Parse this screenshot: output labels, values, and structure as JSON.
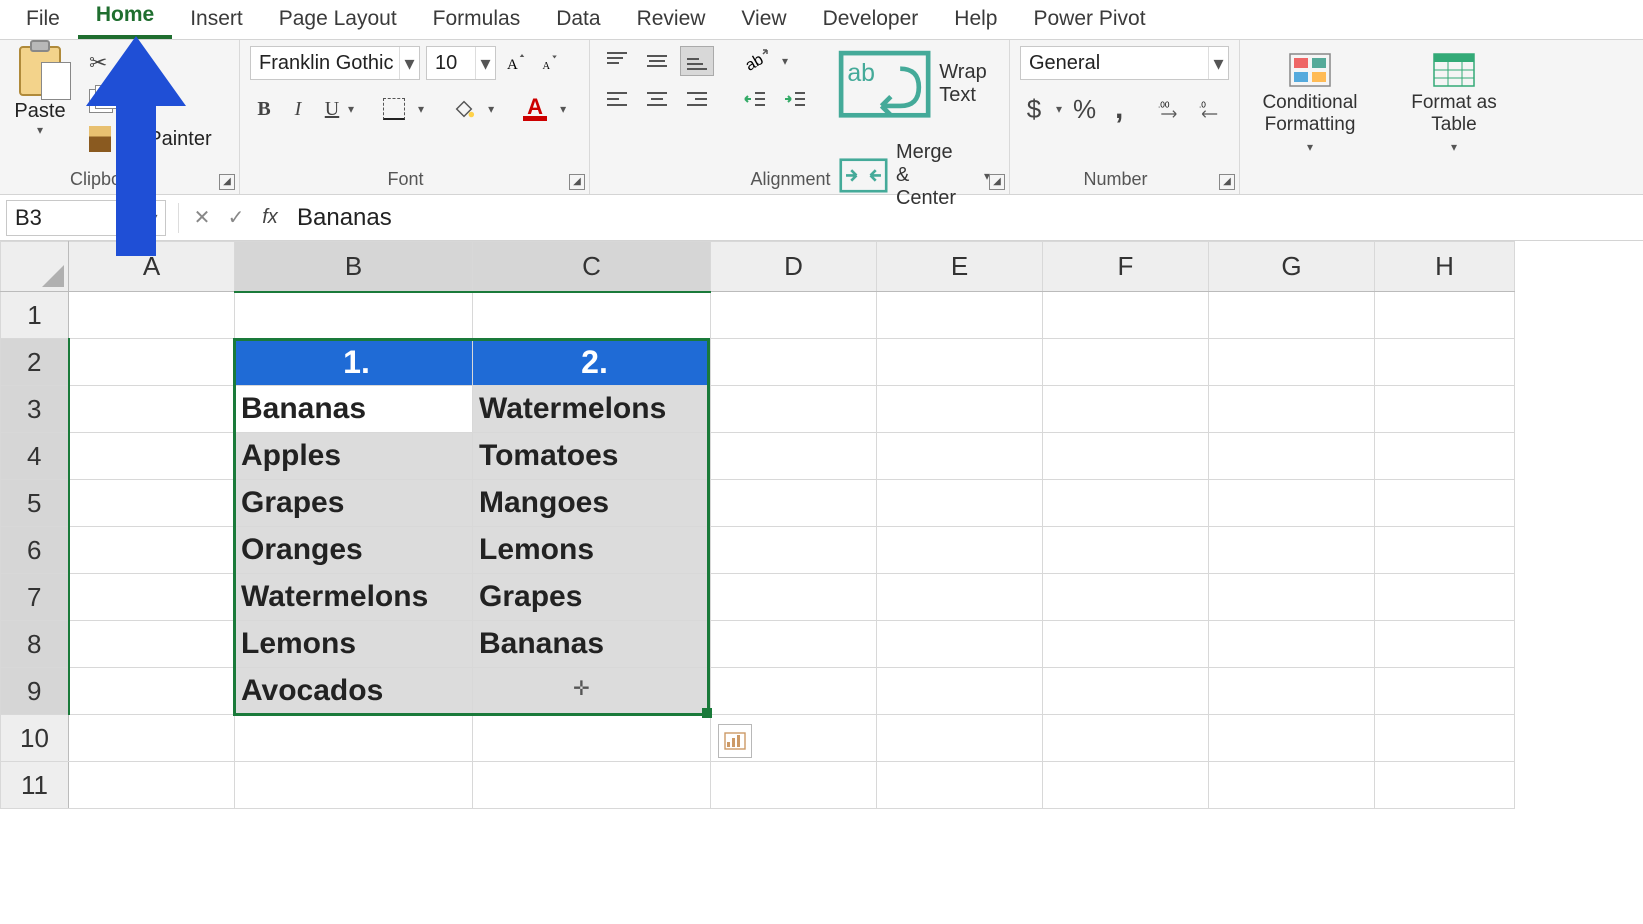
{
  "tabs": {
    "items": [
      "File",
      "Home",
      "Insert",
      "Page Layout",
      "Formulas",
      "Data",
      "Review",
      "View",
      "Developer",
      "Help",
      "Power Pivot"
    ],
    "active": "Home"
  },
  "ribbon": {
    "clipboard": {
      "title": "Clipboard",
      "paste": "Paste",
      "format_painter": "at Painter"
    },
    "font": {
      "title": "Font",
      "name": "Franklin Gothic Me",
      "size": "10",
      "bold": "B",
      "italic": "I",
      "underline": "U",
      "color_letter": "A"
    },
    "alignment": {
      "title": "Alignment",
      "wrap": "Wrap Text",
      "merge": "Merge & Center"
    },
    "number": {
      "title": "Number",
      "format": "General",
      "currency": "$",
      "percent": "%",
      "comma": ",",
      "inc": ".00→.0",
      "dec": ".0→.00"
    },
    "styles": {
      "conditional": "Conditional Formatting",
      "format_table": "Format as Table"
    }
  },
  "namebox": "B3",
  "formula": "Bananas",
  "columns": [
    "A",
    "B",
    "C",
    "D",
    "E",
    "F",
    "G",
    "H"
  ],
  "rows": [
    "1",
    "2",
    "3",
    "4",
    "5",
    "6",
    "7",
    "8",
    "9",
    "10",
    "11"
  ],
  "selected_cols": [
    "B",
    "C"
  ],
  "selected_rows": [
    "2",
    "3",
    "4",
    "5",
    "6",
    "7",
    "8",
    "9"
  ],
  "active_cell": {
    "col": "B",
    "row": "3"
  },
  "table": {
    "headers": [
      "1.",
      "2."
    ],
    "col1": [
      "Bananas",
      "Apples",
      "Grapes",
      "Oranges",
      "Watermelons",
      "Lemons",
      "Avocados"
    ],
    "col2": [
      "Watermelons",
      "Tomatoes",
      "Mangoes",
      "Lemons",
      "Grapes",
      "Bananas",
      ""
    ]
  }
}
